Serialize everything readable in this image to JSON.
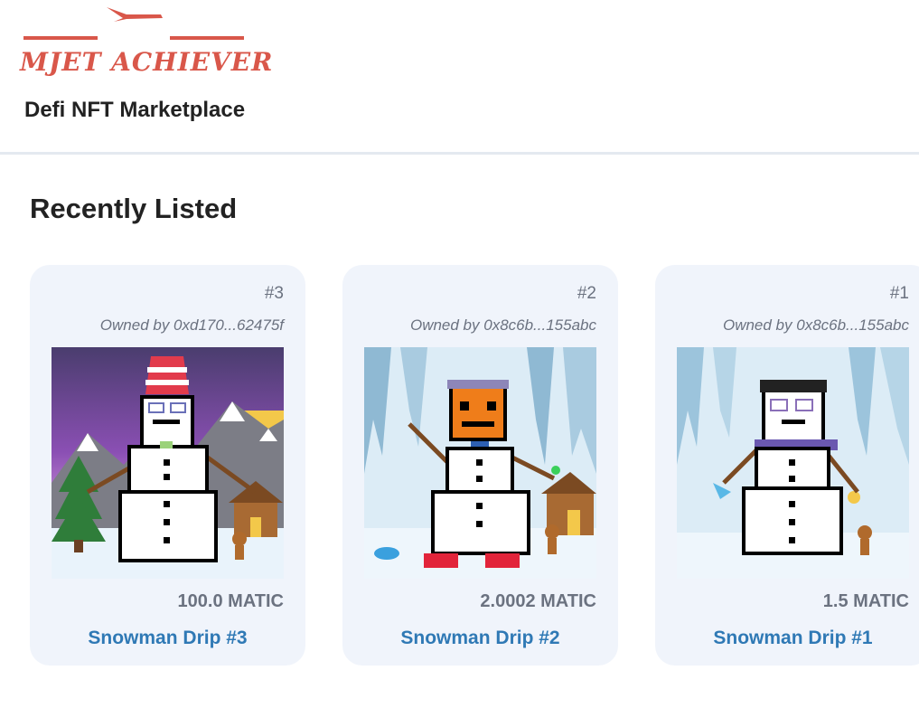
{
  "header": {
    "logo_text": "MJET ACHIEVER",
    "site_title": "Defi NFT Marketplace"
  },
  "section": {
    "title": "Recently Listed"
  },
  "listings": [
    {
      "id": "#3",
      "owner": "Owned by 0xd170...62475f",
      "price": "100.0 MATIC",
      "name": "Snowman Drip #3"
    },
    {
      "id": "#2",
      "owner": "Owned by 0x8c6b...155abc",
      "price": "2.0002 MATIC",
      "name": "Snowman Drip #2"
    },
    {
      "id": "#1",
      "owner": "Owned by 0x8c6b...155abc",
      "price": "1.5 MATIC",
      "name": "Snowman Drip #1"
    }
  ],
  "colors": {
    "brand": "#d9574a",
    "link": "#2f79b5",
    "card_bg": "#f0f4fb",
    "muted": "#6b7280"
  }
}
